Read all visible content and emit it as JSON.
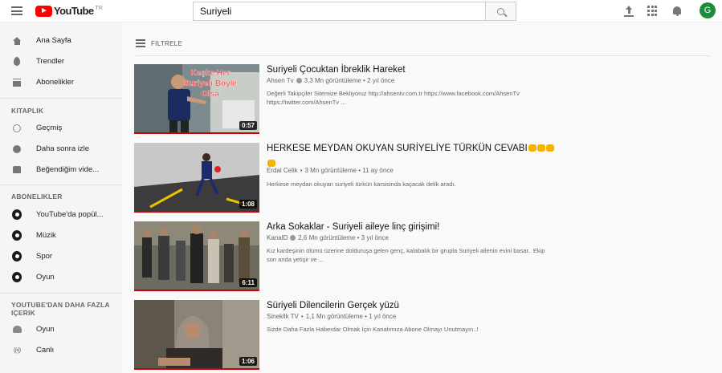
{
  "header": {
    "logo_text": "YouTube",
    "country_code": "TR",
    "search_value": "Suriyeli",
    "avatar_letter": "G"
  },
  "sidebar": {
    "main": [
      {
        "label": "Ana Sayfa",
        "icon": "home-icon"
      },
      {
        "label": "Trendler",
        "icon": "trending-icon"
      },
      {
        "label": "Abonelikler",
        "icon": "subscriptions-icon"
      }
    ],
    "library_heading": "KITAPLIK",
    "library": [
      {
        "label": "Geçmiş",
        "icon": "history-icon"
      },
      {
        "label": "Daha sonra izle",
        "icon": "watch-later-icon"
      },
      {
        "label": "Beğendiğim vide...",
        "icon": "liked-icon"
      }
    ],
    "subs_heading": "ABONELIKLER",
    "subs": [
      {
        "label": "YouTube'da popül...",
        "icon": "popular-channel-icon"
      },
      {
        "label": "Müzik",
        "icon": "music-channel-icon"
      },
      {
        "label": "Spor",
        "icon": "sports-channel-icon"
      },
      {
        "label": "Oyun",
        "icon": "gaming-channel-icon"
      }
    ],
    "more_heading_1": "YOUTUBE'DAN DAHA FAZLA",
    "more_heading_2": "IÇERIK",
    "more": [
      {
        "label": "Oyun",
        "icon": "gaming-icon"
      },
      {
        "label": "Canlı",
        "icon": "live-icon"
      }
    ]
  },
  "filter_label": "FILTRELE",
  "results": [
    {
      "title": "Suriyeli Çocuktan İbreklik Hareket",
      "channel": "Ahsen Tv",
      "verified": true,
      "stats": "3,3 Mn görüntüleme • 2 yıl önce",
      "desc_1": "Değerli Takipçiler Sitemize Bekliyoruz http://ahsentv.com.tr https://www.facebook.com/AhsenTv",
      "desc_2": "https://twitter.com/AhsenTv ...",
      "duration": "0:57",
      "overlay_1": "Keşke Her",
      "overlay_2": "Suriyeli Böyle",
      "overlay_3": "Olsa"
    },
    {
      "title": "HERKESE MEYDAN OKUYAN SURİYELİYE TÜRKÜN CEVABI",
      "channel": "Erdal Celik",
      "verified": false,
      "stats": "3 Mn görüntüleme • 11 ay önce",
      "desc_1": "Herkese meydan okuyan suriyeli türkün karsisinda kaçacak delik aradı.",
      "desc_2": "",
      "duration": "1:08"
    },
    {
      "title": "Arka Sokaklar - Suriyeli aileye linç girişimi!",
      "channel": "KanalD",
      "verified": true,
      "stats": "2,6 Mn görüntüleme • 3 yıl önce",
      "desc_1": "Kız kardeşinin ölümü üzerine dolduruşa gelen genç, kalabalık bir grupla Suriyeli ailenin evini basar.. Ekip",
      "desc_2": "son anda yetişir ve ...",
      "duration": "6:11"
    },
    {
      "title": "Süriyeli Dilencilerin Gerçek yüzü",
      "channel": "Sinekllk TV",
      "verified": false,
      "stats": "1,1 Mn görüntüleme • 1 yıl önce",
      "desc_1": "Sizde Daha Fazla Haberdar Olmak İçin Kanalımıza Abone Olmayı Unutmayın..!",
      "desc_2": "",
      "duration": "1:06"
    }
  ],
  "colors": {
    "brand_red": "#ff0000",
    "avatar_green": "#1b8d3b",
    "progress_red": "#cc0000"
  }
}
